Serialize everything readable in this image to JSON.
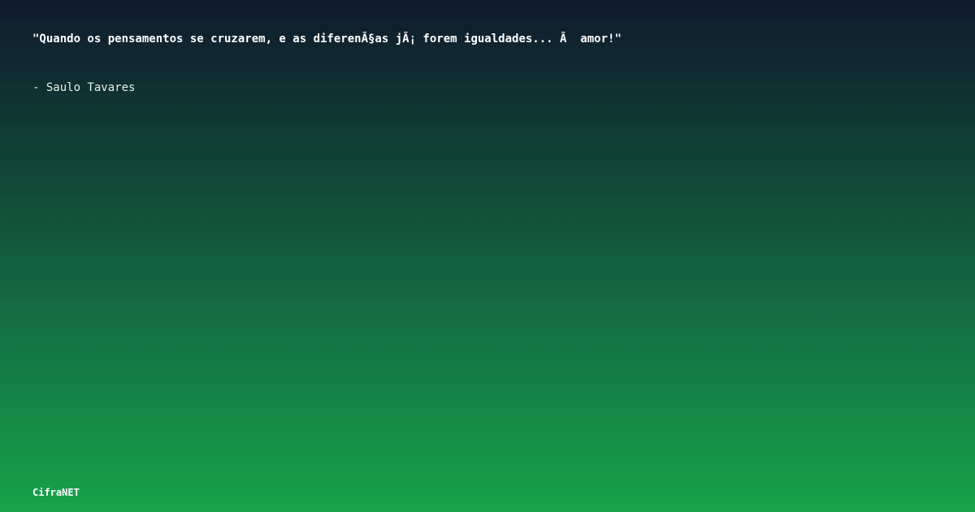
{
  "quote": {
    "text": "\"Quando os pensamentos se cruzarem, e as diferenÃ§as jÃ¡ forem igualdades... Ã  amor!\""
  },
  "author": {
    "text": "- Saulo Tavares"
  },
  "brand": {
    "name": "CifraNET"
  },
  "colors": {
    "background_top": "#0f1a2e",
    "background_bottom": "#16a34a",
    "text": "#ffffff"
  }
}
